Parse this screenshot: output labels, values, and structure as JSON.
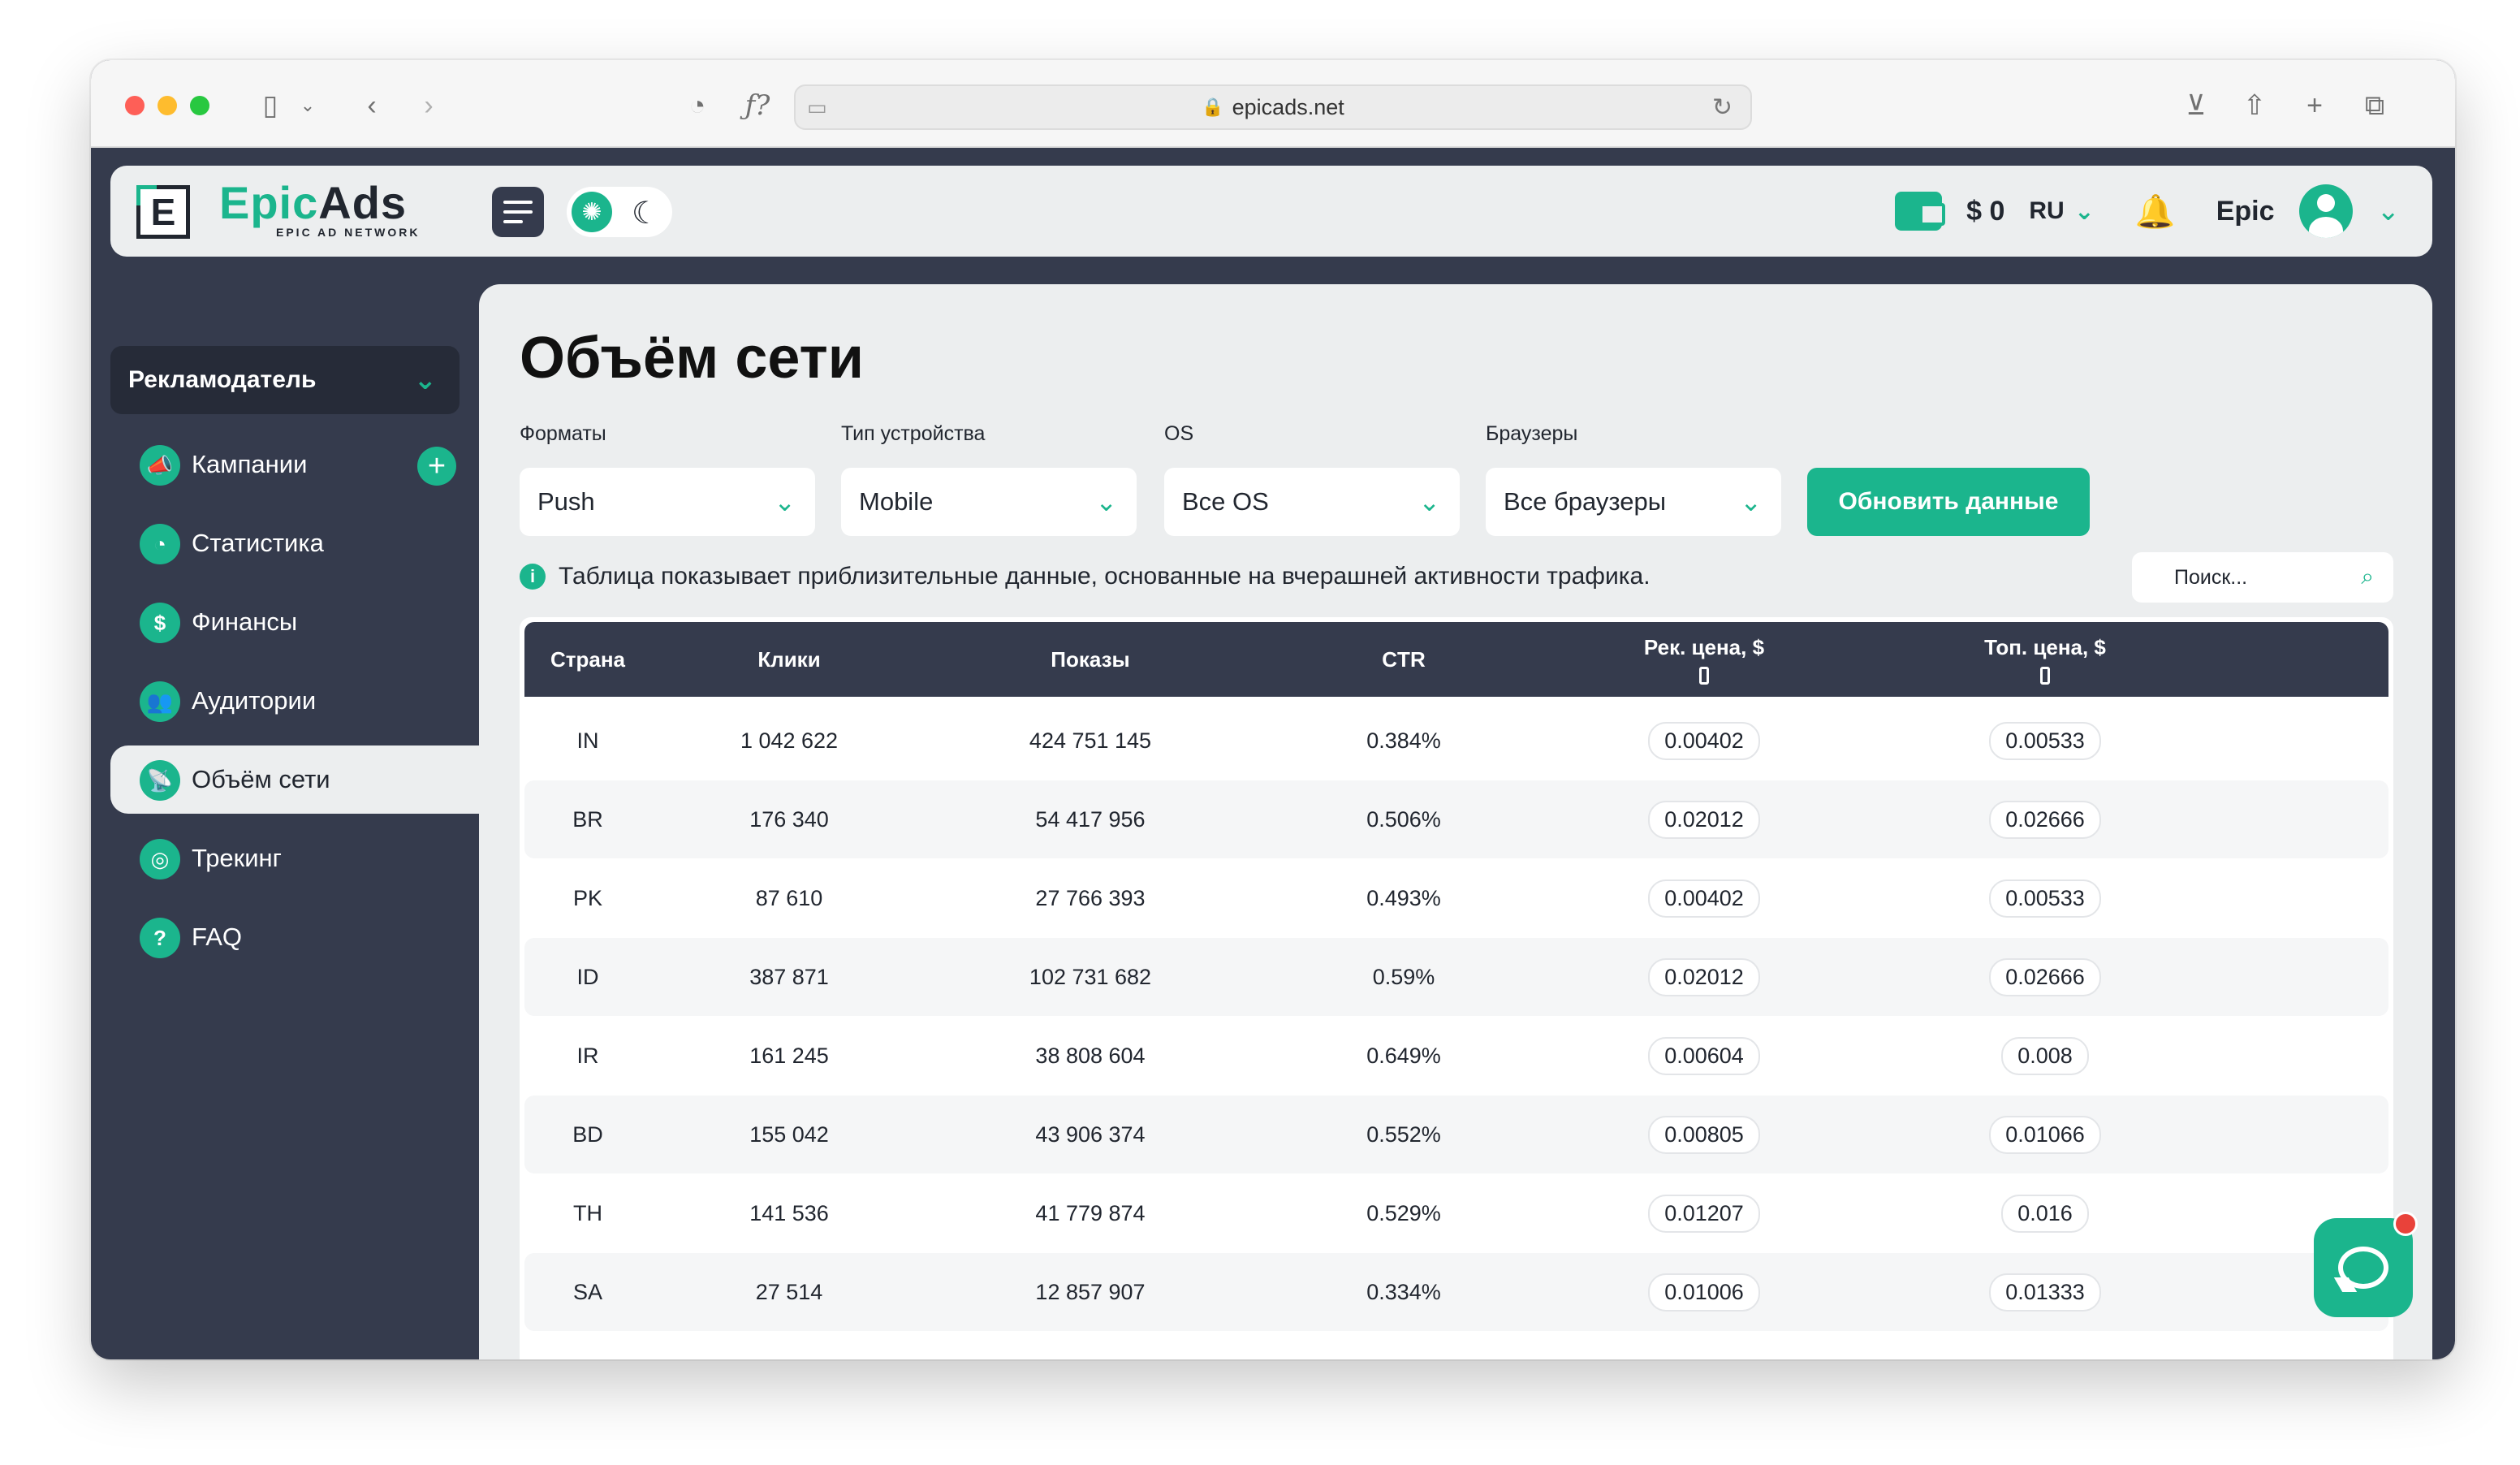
{
  "browser": {
    "url": "epicads.net"
  },
  "header": {
    "logo_letter": "E",
    "logo_brand_1": "Epic",
    "logo_brand_2": "Ads",
    "logo_sub": "EPIC AD NETWORK",
    "balance": "$ 0",
    "language": "RU",
    "user_name": "Epic"
  },
  "sidebar": {
    "role": "Рекламодатель",
    "items": [
      {
        "label": "Кампании",
        "icon": "megaphone-icon"
      },
      {
        "label": "Статистика",
        "icon": "pie-chart-icon"
      },
      {
        "label": "Финансы",
        "icon": "money-icon"
      },
      {
        "label": "Аудитории",
        "icon": "users-icon"
      },
      {
        "label": "Объём сети",
        "icon": "satellite-icon"
      },
      {
        "label": "Трекинг",
        "icon": "target-icon"
      },
      {
        "label": "FAQ",
        "icon": "help-icon"
      }
    ]
  },
  "main": {
    "title": "Объём сети",
    "filters": [
      {
        "label": "Форматы",
        "value": "Push"
      },
      {
        "label": "Тип устройства",
        "value": "Mobile"
      },
      {
        "label": "OS",
        "value": "Все OS"
      },
      {
        "label": "Браузеры",
        "value": "Все браузеры"
      }
    ],
    "refresh_label": "Обновить данные",
    "info_text": "Таблица показывает приблизительные данные, основанные на вчерашней активности трафика.",
    "search_placeholder": "Поиск..."
  },
  "table": {
    "columns": [
      "Страна",
      "Клики",
      "Показы",
      "CTR",
      "Рек. цена, $",
      "Топ. цена, $"
    ],
    "rows": [
      [
        "IN",
        "1 042 622",
        "424 751 145",
        "0.384%",
        "0.00402",
        "0.00533"
      ],
      [
        "BR",
        "176 340",
        "54 417 956",
        "0.506%",
        "0.02012",
        "0.02666"
      ],
      [
        "PK",
        "87 610",
        "27 766 393",
        "0.493%",
        "0.00402",
        "0.00533"
      ],
      [
        "ID",
        "387 871",
        "102 731 682",
        "0.59%",
        "0.02012",
        "0.02666"
      ],
      [
        "IR",
        "161 245",
        "38 808 604",
        "0.649%",
        "0.00604",
        "0.008"
      ],
      [
        "BD",
        "155 042",
        "43 906 374",
        "0.552%",
        "0.00805",
        "0.01066"
      ],
      [
        "TH",
        "141 536",
        "41 779 874",
        "0.529%",
        "0.01207",
        "0.016"
      ],
      [
        "SA",
        "27 514",
        "12 857 907",
        "0.334%",
        "0.01006",
        "0.01333"
      ]
    ]
  },
  "colors": {
    "accent": "#1bb58d",
    "dark": "#353b4d",
    "panel": "#eceeef"
  }
}
